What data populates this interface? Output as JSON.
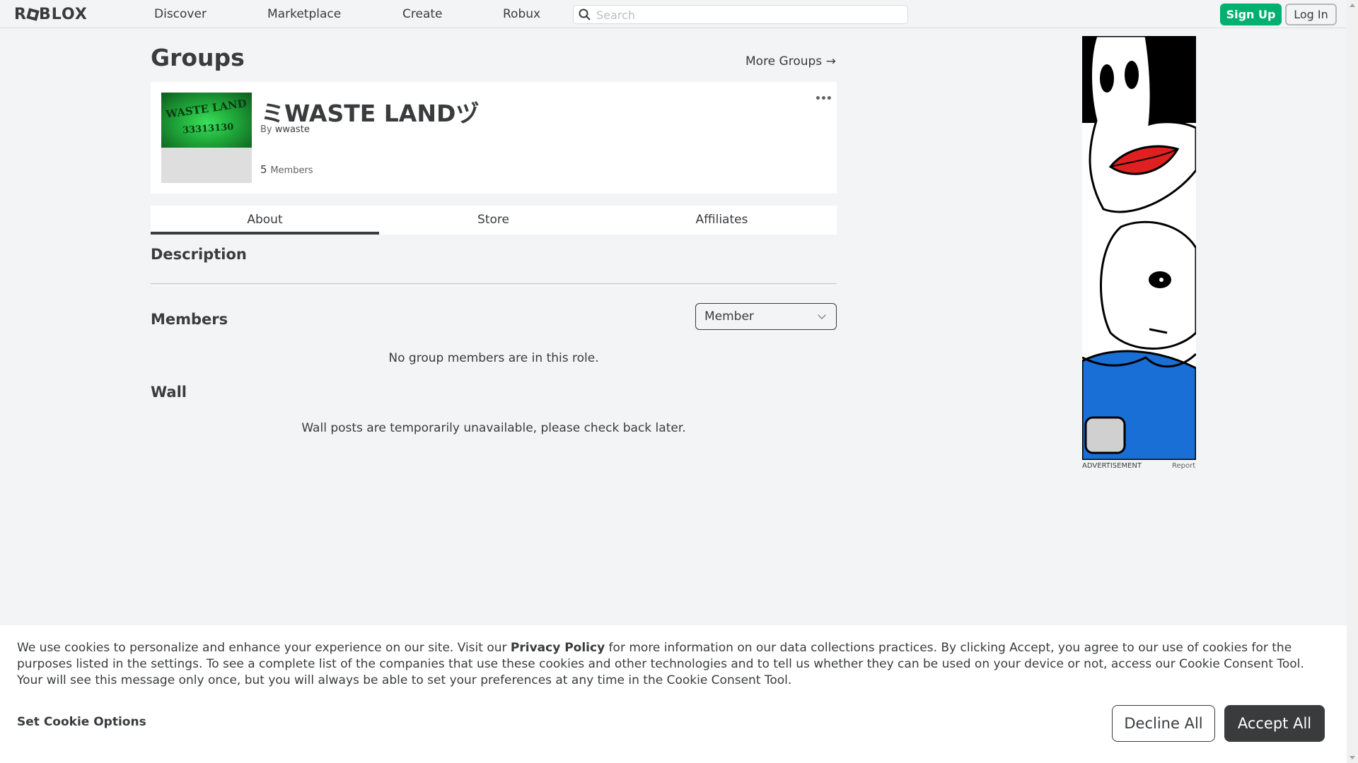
{
  "nav": {
    "logo": "ROBLOX",
    "links": [
      "Discover",
      "Marketplace",
      "Create",
      "Robux"
    ],
    "search_placeholder": "Search",
    "signup": "Sign Up",
    "login": "Log In"
  },
  "page": {
    "title": "Groups",
    "more_groups": "More Groups →"
  },
  "group": {
    "name": "ミWASTE LANDヅ",
    "by_label": "By",
    "owner": "wwaste",
    "member_count": "5",
    "members_label": "Members",
    "thumb_text_1": "WASTE LAND",
    "thumb_text_2": "33313130",
    "more": "•••"
  },
  "tabs": [
    "About",
    "Store",
    "Affiliates"
  ],
  "sections": {
    "description": "Description",
    "members": "Members",
    "role_selected": "Member",
    "no_members": "No group members are in this role.",
    "wall": "Wall",
    "wall_unavailable": "Wall posts are temporarily unavailable, please check back later."
  },
  "ad": {
    "label": "ADVERTISEMENT",
    "report": "Report"
  },
  "cookie": {
    "text_before": "We use cookies to personalize and enhance your experience on our site. Visit our ",
    "privacy_policy": "Privacy Policy",
    "text_after": " for more information on our data collections practices. By clicking Accept, you agree to our use of cookies for the purposes listed in the settings. To see a complete list of the companies that use these cookies and other technologies and to tell us whether they can be used on your device or not, access our Cookie Consent Tool. Your will see this message only once, but you will always be able to set your preferences at any time in the Cookie Consent Tool.",
    "set_options": "Set Cookie Options",
    "decline": "Decline All",
    "accept": "Accept All"
  },
  "colors": {
    "signup_green": "#00b06f",
    "text_dark": "#393b3d",
    "page_bg": "#f2f4f5"
  }
}
